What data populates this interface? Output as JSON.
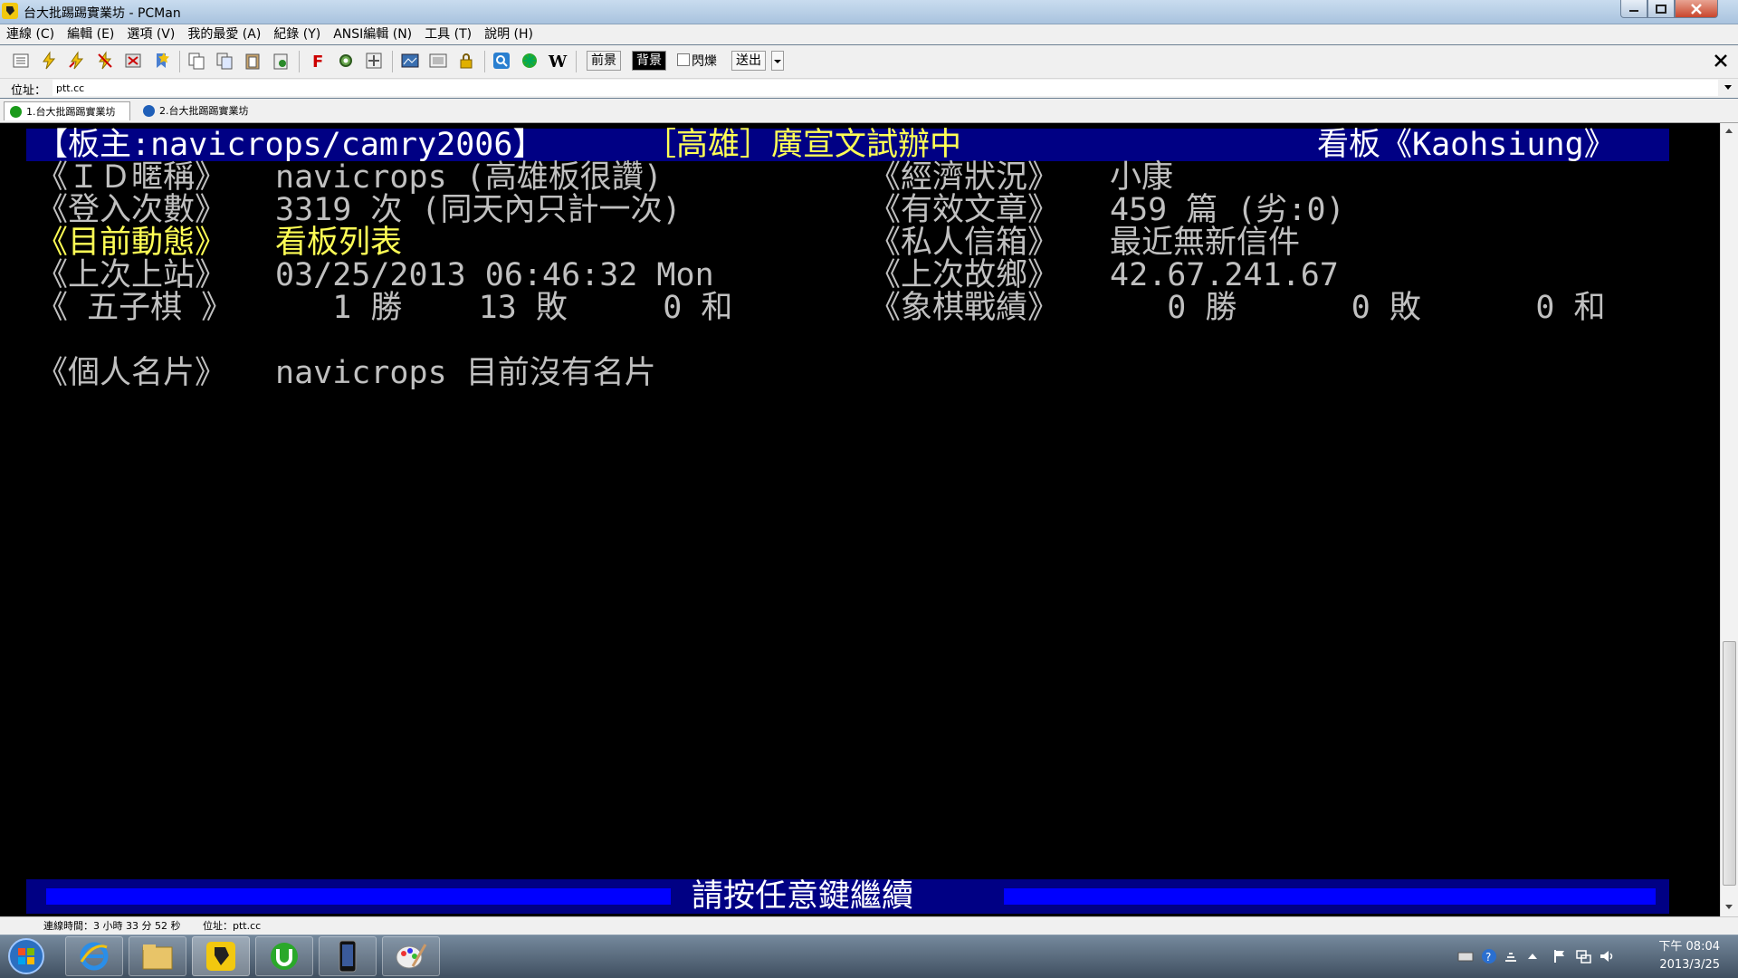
{
  "window": {
    "title": "台大批踢踢實業坊 - PCMan",
    "icons": {
      "app": "pcman-icon",
      "minimize": "minimize-icon",
      "maximize": "maximize-icon",
      "close": "close-icon"
    }
  },
  "menu": [
    {
      "label": "連線 (C)"
    },
    {
      "label": "編輯 (E)"
    },
    {
      "label": "選項 (V)"
    },
    {
      "label": "我的最愛 (A)"
    },
    {
      "label": "紀錄 (Y)"
    },
    {
      "label": "ANSI編輯 (N)"
    },
    {
      "label": "工具 (T)"
    },
    {
      "label": "說明 (H)"
    }
  ],
  "toolbar": {
    "foreground_label": "前景",
    "background_label": "背景",
    "blink_label": "閃爍",
    "send_label": "送出",
    "wiki_label": "W",
    "font_label": "F"
  },
  "address": {
    "label": "位址：",
    "value": "ptt.cc"
  },
  "tabs": [
    {
      "label": "1.台大批踢踢實業坊",
      "active": true,
      "color": "#1a9a1a"
    },
    {
      "label": "2.台大批踢踢實業坊",
      "active": false,
      "color": "#1f5fb8"
    }
  ],
  "terminal": {
    "header": {
      "moderator": "【板主:navicrops/camry2006】",
      "board_title": "［高雄］廣宣文試辦中",
      "board_name": "看板《Kaohsiung》"
    },
    "rows": [
      {
        "left_label": "《ＩＤ暱稱》",
        "left_value": "navicrops (高雄板很讚)",
        "right_label": "《經濟狀況》",
        "right_value": "小康"
      },
      {
        "left_label": "《登入次數》",
        "left_value": "3319 次 (同天內只計一次)",
        "right_label": "《有效文章》",
        "right_value": "459 篇 (劣:0)"
      },
      {
        "left_label": "《目前動態》",
        "left_value": "看板列表",
        "right_label": "《私人信箱》",
        "right_value": "最近無新信件"
      },
      {
        "left_label": "《上次上站》",
        "left_value": "03/25/2013 06:46:32 Mon",
        "right_label": "《上次故鄉》",
        "right_value": "42.67.241.67"
      },
      {
        "left_label": "《 五子棋 》",
        "left_value": "   1 勝    13 敗     0 和",
        "right_label": "《象棋戰績》",
        "right_value": "   0 勝      0 敗      0 和"
      }
    ],
    "card_label": "《個人名片》",
    "card_value": "navicrops 目前沒有名片",
    "footer": "請按任意鍵繼續",
    "colors": {
      "bar": "#000084",
      "bar_highlight": "#0000ff",
      "yellow": "#ffff55",
      "gray": "#c0c0c0",
      "white": "#ffffff"
    }
  },
  "statusbar": {
    "connect_time": "連線時間：3 小時 33 分 52 秒",
    "address": "位址：ptt.cc"
  },
  "taskbar": {
    "apps": [
      {
        "name": "internet-explorer-icon"
      },
      {
        "name": "file-explorer-icon"
      },
      {
        "name": "pcman-icon"
      },
      {
        "name": "utorrent-icon"
      },
      {
        "name": "phone-icon"
      },
      {
        "name": "paint-icon"
      }
    ],
    "clock": {
      "time": "下午 08:04",
      "date": "2013/3/25"
    }
  }
}
